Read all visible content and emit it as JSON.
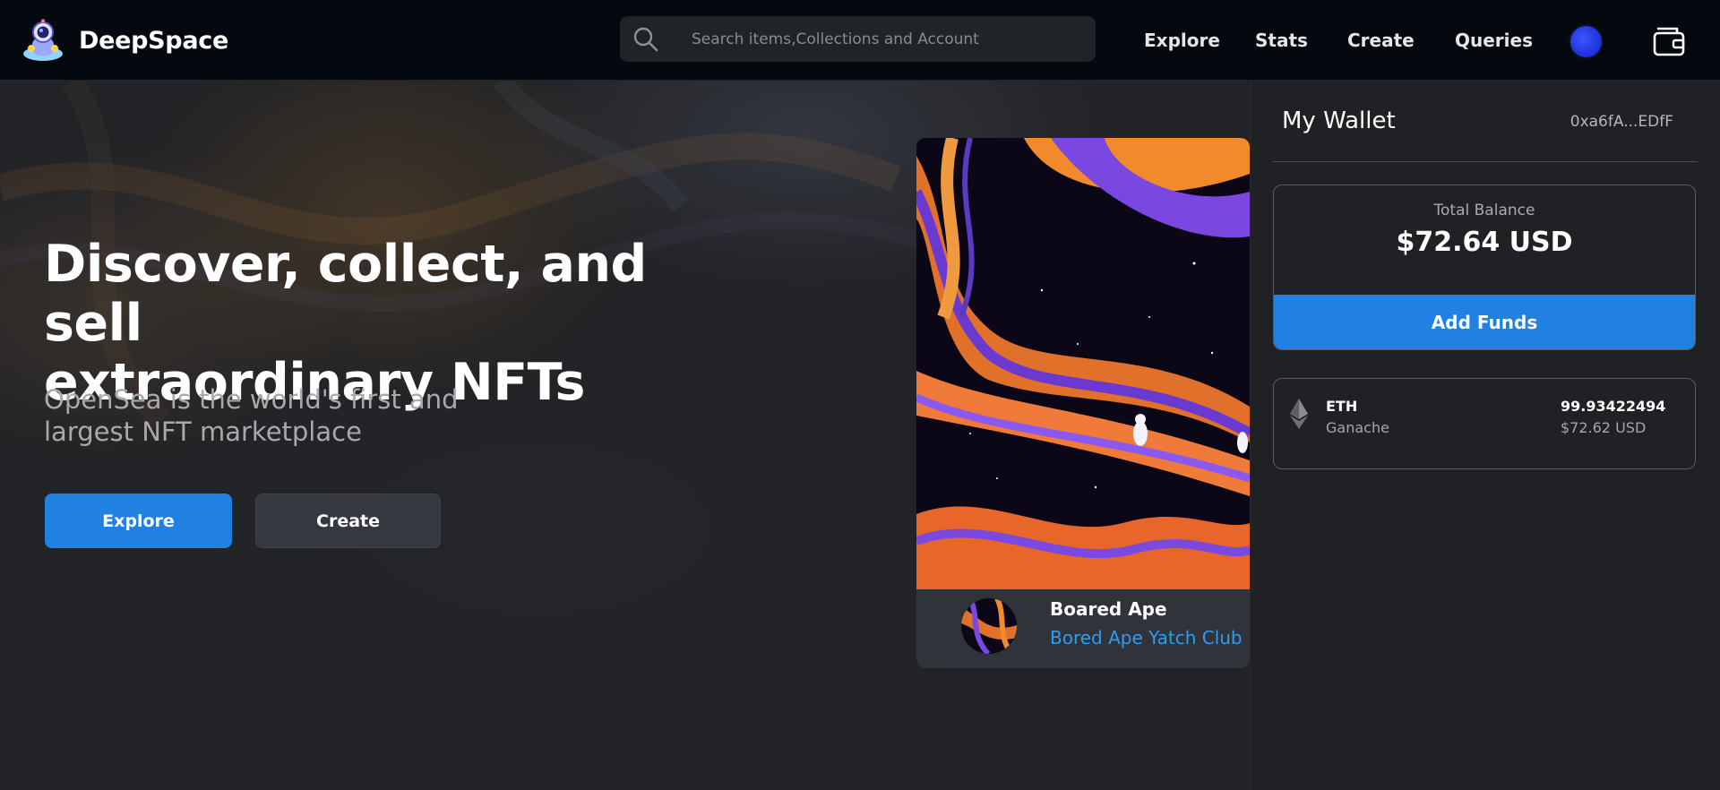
{
  "header": {
    "brand": "DeepSpace",
    "search_placeholder": "Search items,Collections and Account",
    "nav": [
      "Explore",
      "Stats",
      "Create",
      "Queries"
    ]
  },
  "hero": {
    "headline_line1": "Discover, collect, and sell",
    "headline_line2": "extraordinary NFTs",
    "sub_line1": "OpenSea is the world's first and",
    "sub_line2": "largest NFT marketplace",
    "explore_label": "Explore",
    "create_label": "Create"
  },
  "nft_card": {
    "name": "Boared Ape",
    "collection": "Bored Ape Yatch Club"
  },
  "wallet": {
    "title": "My Wallet",
    "address": "0xa6fA...EDfF",
    "total_balance_label": "Total Balance",
    "total_balance_value": "$72.64 USD",
    "add_funds_label": "Add Funds",
    "token": {
      "symbol": "ETH",
      "network": "Ganache",
      "amount": "99.93422494",
      "usd": "$72.62 USD"
    }
  },
  "colors": {
    "accent": "#2081e2",
    "link": "#2e9cf1",
    "header_bg": "#03090f",
    "page_bg": "#202124"
  },
  "icons": [
    "astronaut-logo-icon",
    "search-icon",
    "avatar-icon",
    "wallet-icon",
    "eth-icon"
  ]
}
